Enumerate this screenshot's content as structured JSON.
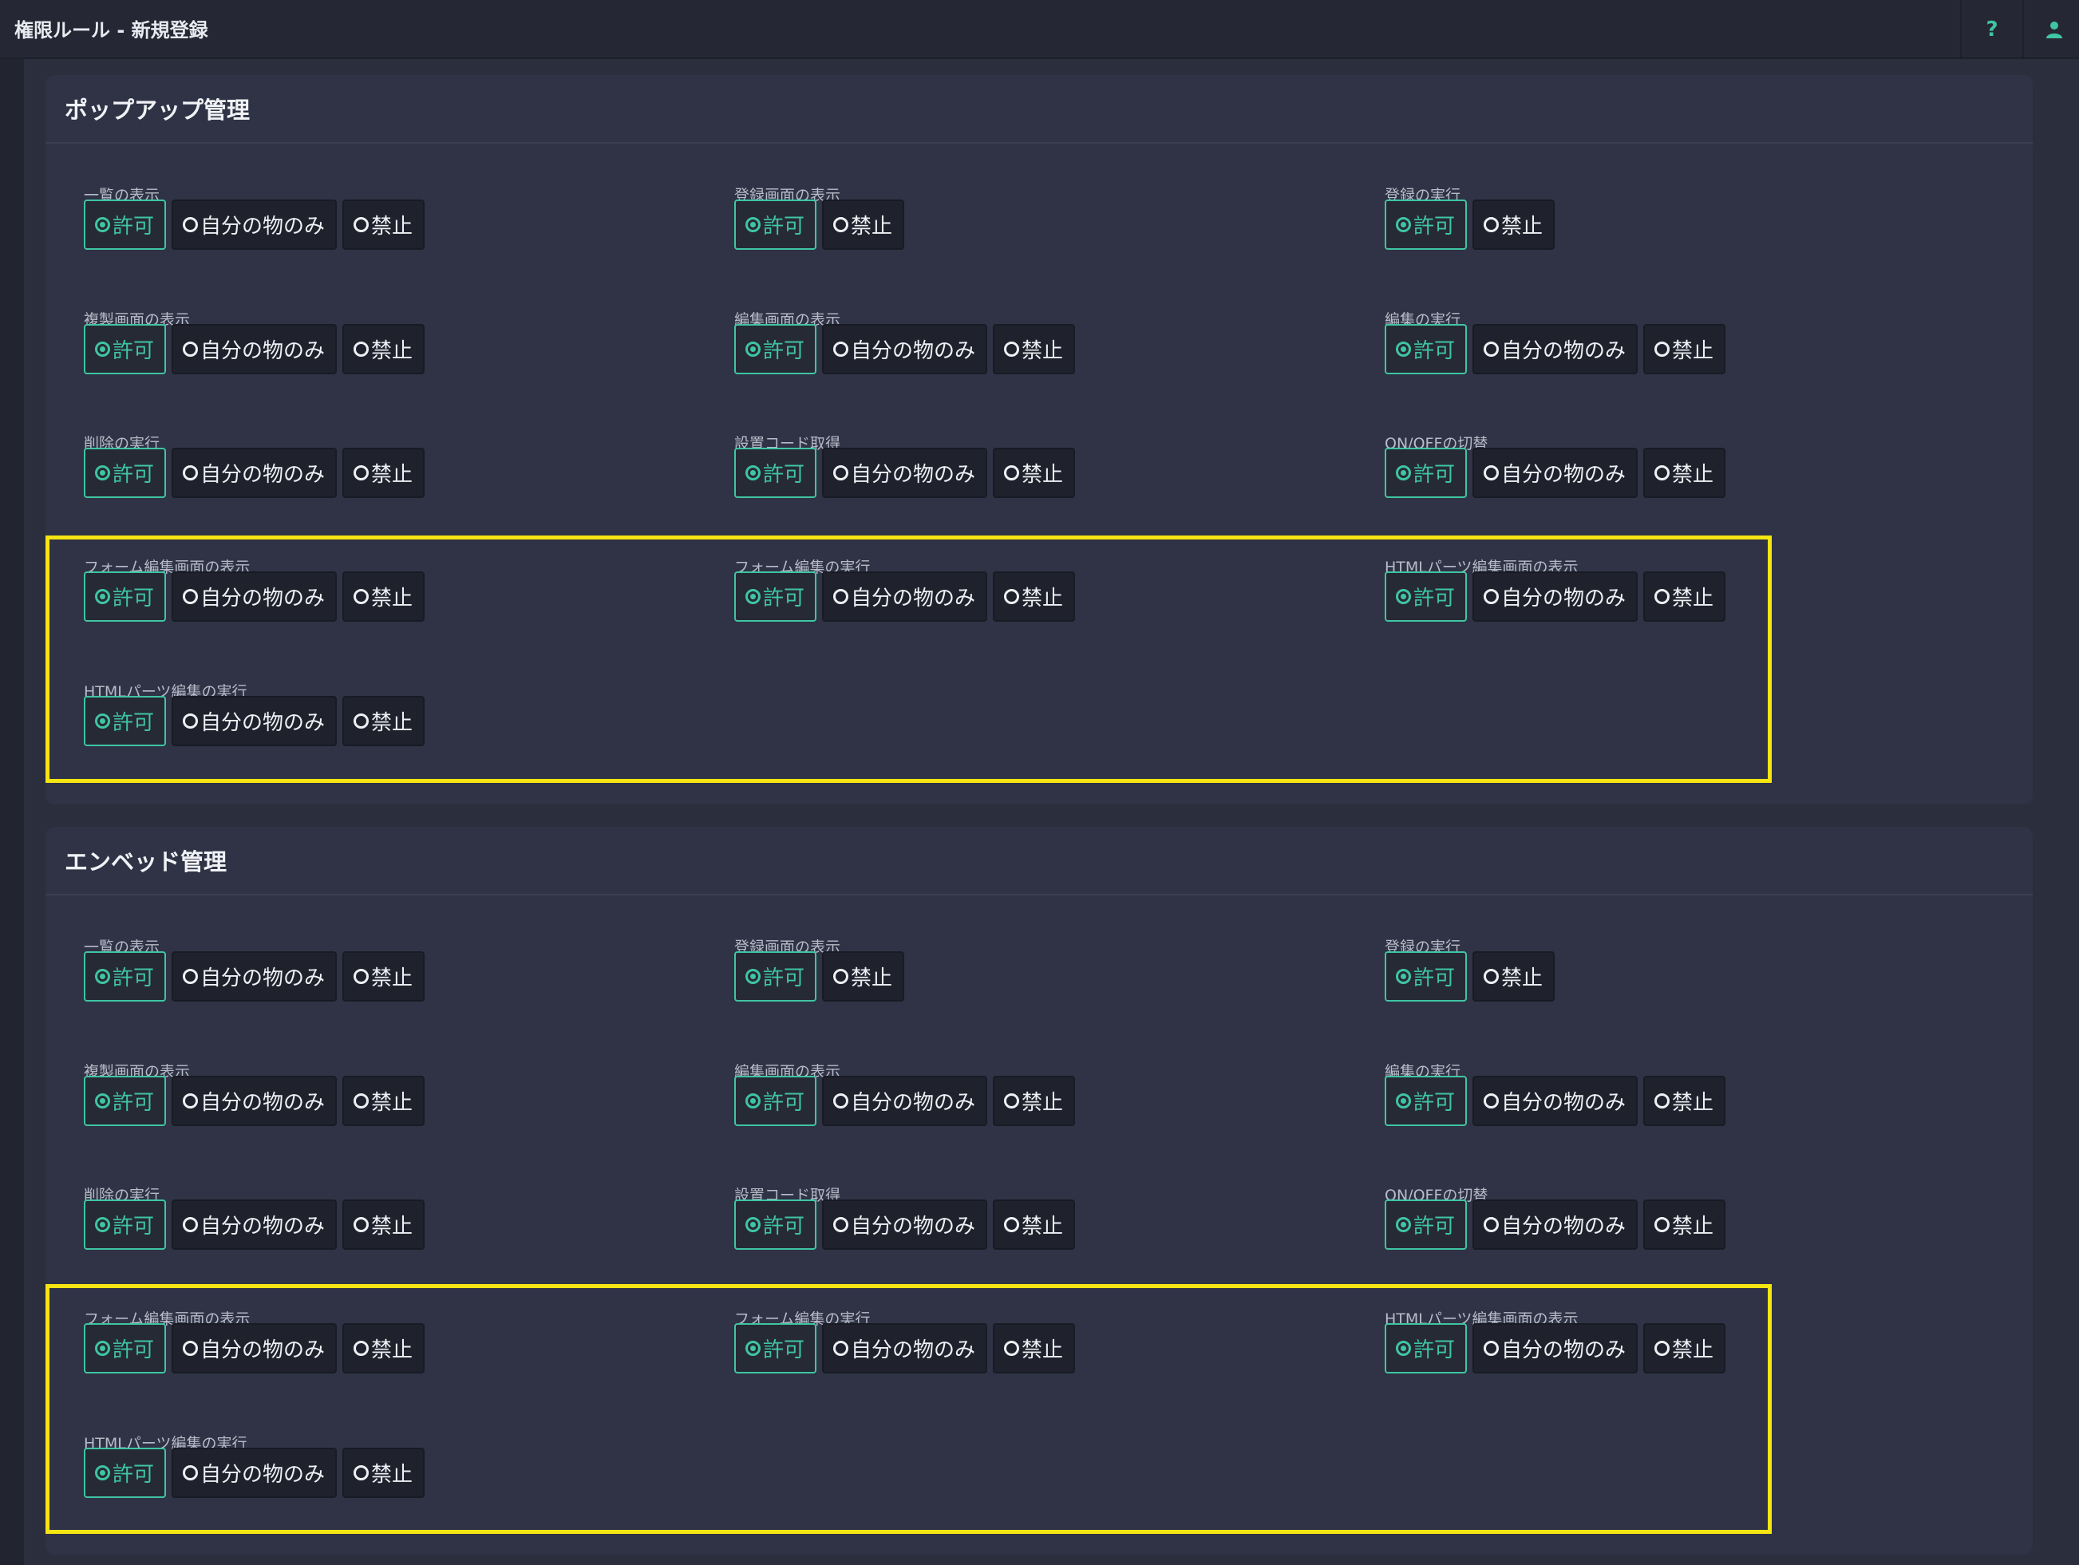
{
  "header": {
    "title": "権限ルール - 新規登録",
    "help_icon": "?",
    "user_icon": "user-icon"
  },
  "colors": {
    "accent": "#3fc5a2",
    "highlight": "#f5e512",
    "background": "#2a2e3d",
    "panel": "#2f3345"
  },
  "options": {
    "allow": "許可",
    "own": "自分の物のみ",
    "deny": "禁止"
  },
  "sections": [
    {
      "title": "ポップアップ管理",
      "fields": [
        {
          "label": "一覧の表示",
          "options": [
            "許可",
            "自分の物のみ",
            "禁止"
          ],
          "selected": "許可"
        },
        {
          "label": "登録画面の表示",
          "options": [
            "許可",
            "禁止"
          ],
          "selected": "許可"
        },
        {
          "label": "登録の実行",
          "options": [
            "許可",
            "禁止"
          ],
          "selected": "許可"
        },
        {
          "label": "複製画面の表示",
          "options": [
            "許可",
            "自分の物のみ",
            "禁止"
          ],
          "selected": "許可"
        },
        {
          "label": "編集画面の表示",
          "options": [
            "許可",
            "自分の物のみ",
            "禁止"
          ],
          "selected": "許可"
        },
        {
          "label": "編集の実行",
          "options": [
            "許可",
            "自分の物のみ",
            "禁止"
          ],
          "selected": "許可"
        },
        {
          "label": "削除の実行",
          "options": [
            "許可",
            "自分の物のみ",
            "禁止"
          ],
          "selected": "許可"
        },
        {
          "label": "設置コード取得",
          "options": [
            "許可",
            "自分の物のみ",
            "禁止"
          ],
          "selected": "許可"
        },
        {
          "label": "ON/OFFの切替",
          "options": [
            "許可",
            "自分の物のみ",
            "禁止"
          ],
          "selected": "許可"
        },
        {
          "label": "フォーム編集画面の表示",
          "options": [
            "許可",
            "自分の物のみ",
            "禁止"
          ],
          "selected": "許可"
        },
        {
          "label": "フォーム編集の実行",
          "options": [
            "許可",
            "自分の物のみ",
            "禁止"
          ],
          "selected": "許可"
        },
        {
          "label": "HTMLパーツ編集画面の表示",
          "options": [
            "許可",
            "自分の物のみ",
            "禁止"
          ],
          "selected": "許可"
        },
        {
          "label": "HTMLパーツ編集の実行",
          "options": [
            "許可",
            "自分の物のみ",
            "禁止"
          ],
          "selected": "許可"
        }
      ]
    },
    {
      "title": "エンベッド管理",
      "fields": [
        {
          "label": "一覧の表示",
          "options": [
            "許可",
            "自分の物のみ",
            "禁止"
          ],
          "selected": "許可"
        },
        {
          "label": "登録画面の表示",
          "options": [
            "許可",
            "禁止"
          ],
          "selected": "許可"
        },
        {
          "label": "登録の実行",
          "options": [
            "許可",
            "禁止"
          ],
          "selected": "許可"
        },
        {
          "label": "複製画面の表示",
          "options": [
            "許可",
            "自分の物のみ",
            "禁止"
          ],
          "selected": "許可"
        },
        {
          "label": "編集画面の表示",
          "options": [
            "許可",
            "自分の物のみ",
            "禁止"
          ],
          "selected": "許可"
        },
        {
          "label": "編集の実行",
          "options": [
            "許可",
            "自分の物のみ",
            "禁止"
          ],
          "selected": "許可"
        },
        {
          "label": "削除の実行",
          "options": [
            "許可",
            "自分の物のみ",
            "禁止"
          ],
          "selected": "許可"
        },
        {
          "label": "設置コード取得",
          "options": [
            "許可",
            "自分の物のみ",
            "禁止"
          ],
          "selected": "許可"
        },
        {
          "label": "ON/OFFの切替",
          "options": [
            "許可",
            "自分の物のみ",
            "禁止"
          ],
          "selected": "許可"
        },
        {
          "label": "フォーム編集画面の表示",
          "options": [
            "許可",
            "自分の物のみ",
            "禁止"
          ],
          "selected": "許可"
        },
        {
          "label": "フォーム編集の実行",
          "options": [
            "許可",
            "自分の物のみ",
            "禁止"
          ],
          "selected": "許可"
        },
        {
          "label": "HTMLパーツ編集画面の表示",
          "options": [
            "許可",
            "自分の物のみ",
            "禁止"
          ],
          "selected": "許可"
        },
        {
          "label": "HTMLパーツ編集の実行",
          "options": [
            "許可",
            "自分の物のみ",
            "禁止"
          ],
          "selected": "許可"
        }
      ]
    }
  ]
}
